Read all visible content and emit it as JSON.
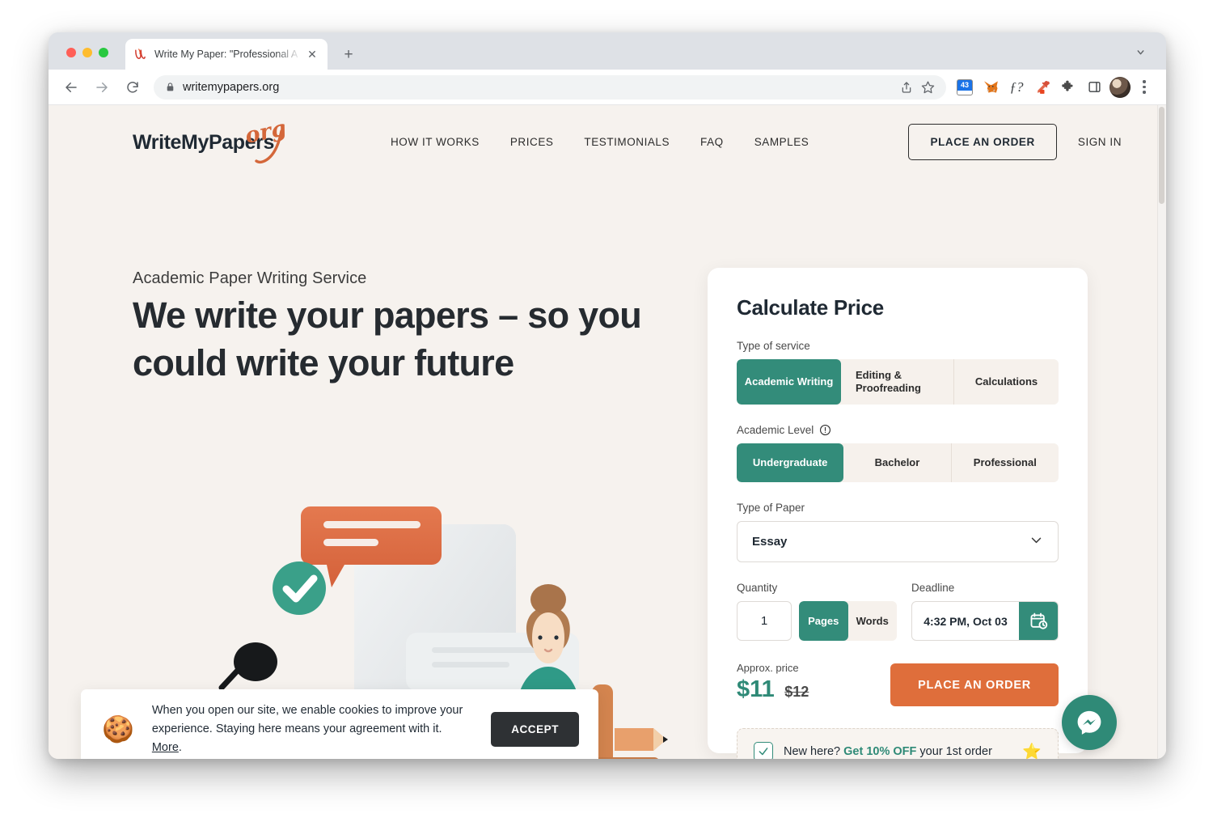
{
  "browser": {
    "tab": {
      "title": "Write My Paper: \"Professional A",
      "favicon_icon": "writemypapers-w-icon",
      "close_icon": "close-icon"
    },
    "new_tab_label": "+",
    "tabstrip_chevron_icon": "chevron-down-icon",
    "nav": {
      "back_icon": "arrow-left-icon",
      "forward_icon": "arrow-right-icon",
      "reload_icon": "reload-icon"
    },
    "omnibox": {
      "url": "writemypapers.org",
      "lock_icon": "lock-icon",
      "share_icon": "share-icon",
      "bookmark_icon": "star-icon"
    },
    "extensions": [
      {
        "name": "badge-43-icon",
        "label": "43"
      },
      {
        "name": "metamask-fox-icon",
        "label": ""
      },
      {
        "name": "f-question-icon",
        "label": "ƒ?"
      },
      {
        "name": "eyedropper-icon",
        "label": ""
      },
      {
        "name": "puzzle-extension-icon",
        "label": ""
      },
      {
        "name": "side-panel-icon",
        "label": ""
      }
    ],
    "avatar_icon": "profile-avatar",
    "menu_icon": "three-dots-menu-icon"
  },
  "site": {
    "logo": {
      "text": "WriteMyPapers",
      "suffix": "org"
    },
    "nav": [
      {
        "label": "HOW IT WORKS"
      },
      {
        "label": "PRICES"
      },
      {
        "label": "TESTIMONIALS"
      },
      {
        "label": "FAQ"
      },
      {
        "label": "SAMPLES"
      }
    ],
    "place_order_header": "PLACE AN ORDER",
    "sign_in": "SIGN IN"
  },
  "hero": {
    "eyebrow": "Academic Paper Writing Service",
    "title": "We write your papers – so you could write your future"
  },
  "calculator": {
    "title": "Calculate Price",
    "service": {
      "label": "Type of service",
      "options": [
        "Academic Writing",
        "Editing & Proofreading",
        "Calculations"
      ],
      "selected": "Academic Writing"
    },
    "level": {
      "label": "Academic Level",
      "info_icon": "info-circle-icon",
      "options": [
        "Undergraduate",
        "Bachelor",
        "Professional"
      ],
      "selected": "Undergraduate"
    },
    "paper": {
      "label": "Type of Paper",
      "value": "Essay",
      "caret_icon": "chevron-down-icon"
    },
    "quantity": {
      "label": "Quantity",
      "value": "1",
      "units": [
        "Pages",
        "Words"
      ],
      "selected_unit": "Pages"
    },
    "deadline": {
      "label": "Deadline",
      "value": "4:32 PM, Oct 03",
      "icon": "calendar-clock-icon"
    },
    "price": {
      "label": "Approx. price",
      "current": "$11",
      "old": "$12"
    },
    "cta": "PLACE AN ORDER",
    "promo": {
      "check_icon": "checkmark-icon",
      "lead": "New here? ",
      "highlight": "Get 10% OFF",
      "tail": " your 1st order",
      "star_icon": "star-emoji"
    }
  },
  "cookie": {
    "emoji_icon": "cookie-emoji",
    "text_part1": "When you open our site, we enable cookies to improve your experience. Staying here means your agreement with it. ",
    "more_link": "More",
    "text_part2": ".",
    "accept": "ACCEPT"
  },
  "messenger": {
    "icon": "facebook-messenger-icon"
  },
  "colors": {
    "page_bg": "#f6f2ee",
    "teal": "#338c7a",
    "teal_text": "#2f8a77",
    "orange": "#df6e3b",
    "logo_orange": "#d4673a",
    "dark": "#1f2933",
    "segment_bg": "#f6f1ec"
  }
}
